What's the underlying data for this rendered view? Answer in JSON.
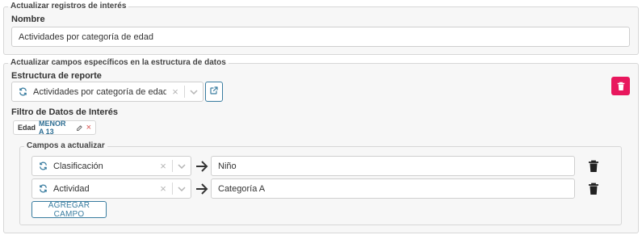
{
  "interest_records": {
    "legend": "Actualizar registros de interés",
    "name_label": "Nombre",
    "name_value": "Actividades por categoría de edad"
  },
  "specific_fields": {
    "legend": "Actualizar campos específicos en la estructura de datos",
    "report_structure_label": "Estructura de reporte",
    "report_structure_value": "Actividades por categoría de edad",
    "filter_label": "Filtro de Datos de Interés",
    "filter_chip": {
      "field": "Edad",
      "condition": "MENOR A 13"
    },
    "fields_to_update": {
      "legend": "Campos a actualizar",
      "rows": [
        {
          "field": "Clasificación",
          "value": "Niño"
        },
        {
          "field": "Actividad",
          "value": "Categoría A"
        }
      ],
      "add_button": "AGREGAR CAMPO"
    }
  },
  "colors": {
    "accent": "#3a7da0",
    "danger": "#e8175d",
    "chip_condition": "#2e6e93",
    "chip_delete": "#d9534f"
  }
}
